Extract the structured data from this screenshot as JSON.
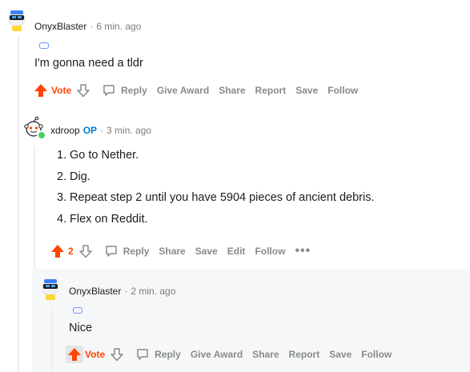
{
  "comments": [
    {
      "username": "OnyxBlaster",
      "separator": "·",
      "time": "6 min. ago",
      "text": "I'm gonna need a tldr",
      "vote_label": "Vote",
      "actions": {
        "reply": "Reply",
        "award": "Give Award",
        "share": "Share",
        "report": "Report",
        "save": "Save",
        "follow": "Follow"
      }
    },
    {
      "username": "xdroop",
      "op_label": "OP",
      "separator": "·",
      "time": "3 min. ago",
      "list": [
        "Go to Nether.",
        "Dig.",
        "Repeat step 2 until you have 5904 pieces of ancient debris.",
        "Flex on Reddit."
      ],
      "vote_label": "2",
      "actions": {
        "reply": "Reply",
        "share": "Share",
        "save": "Save",
        "edit": "Edit",
        "follow": "Follow",
        "more": "•••"
      }
    },
    {
      "username": "OnyxBlaster",
      "separator": "·",
      "time": "2 min. ago",
      "text": "Nice",
      "vote_label": "Vote",
      "actions": {
        "reply": "Reply",
        "award": "Give Award",
        "share": "Share",
        "report": "Report",
        "save": "Save",
        "follow": "Follow"
      }
    }
  ],
  "colors": {
    "upvote": "#ff4500",
    "op": "#0079d3",
    "online": "#46d160",
    "highlight": "#f6f7f8",
    "meta": "#7c7c7c",
    "action": "#878a8c"
  }
}
